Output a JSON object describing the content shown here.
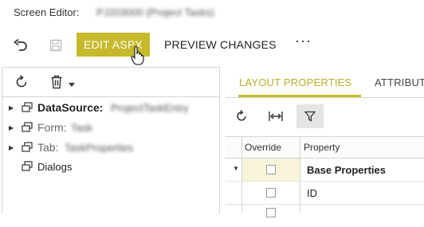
{
  "header": {
    "label": "Screen Editor:",
    "screen_value": "PJ203000 (Project Tasks)"
  },
  "toolbar": {
    "undo_icon": "undo-icon",
    "save_icon": "save-icon",
    "edit_aspx_label": "EDIT ASPX",
    "preview_label": "PREVIEW CHANGES",
    "more_label": "···",
    "accent": "#c6b92c"
  },
  "left_toolbar": {
    "refresh_icon": "refresh-icon",
    "delete_icon": "trash-icon",
    "dropdown_icon": "caret-down-icon"
  },
  "tree": {
    "items": [
      {
        "label": "DataSource:",
        "value": "ProjectTaskEntry",
        "bold": true,
        "expandable": true
      },
      {
        "label": "Form:",
        "value": "Task",
        "bold": false,
        "expandable": true
      },
      {
        "label": "Tab:",
        "value": "TaskProperties",
        "bold": false,
        "expandable": true
      },
      {
        "label": "Dialogs",
        "value": "",
        "bold": false,
        "expandable": false
      }
    ]
  },
  "tabs": [
    {
      "label": "LAYOUT PROPERTIES",
      "active": true
    },
    {
      "label": "ATTRIBUTES",
      "active": false
    }
  ],
  "grid_toolbar": {
    "refresh_icon": "refresh-icon",
    "fit_icon": "fit-columns-icon",
    "filter_icon": "filter-icon"
  },
  "grid": {
    "headers": [
      "Override",
      "Property"
    ],
    "rows": [
      {
        "property": "Base Properties",
        "group": true
      },
      {
        "property": "ID",
        "group": false
      }
    ]
  }
}
